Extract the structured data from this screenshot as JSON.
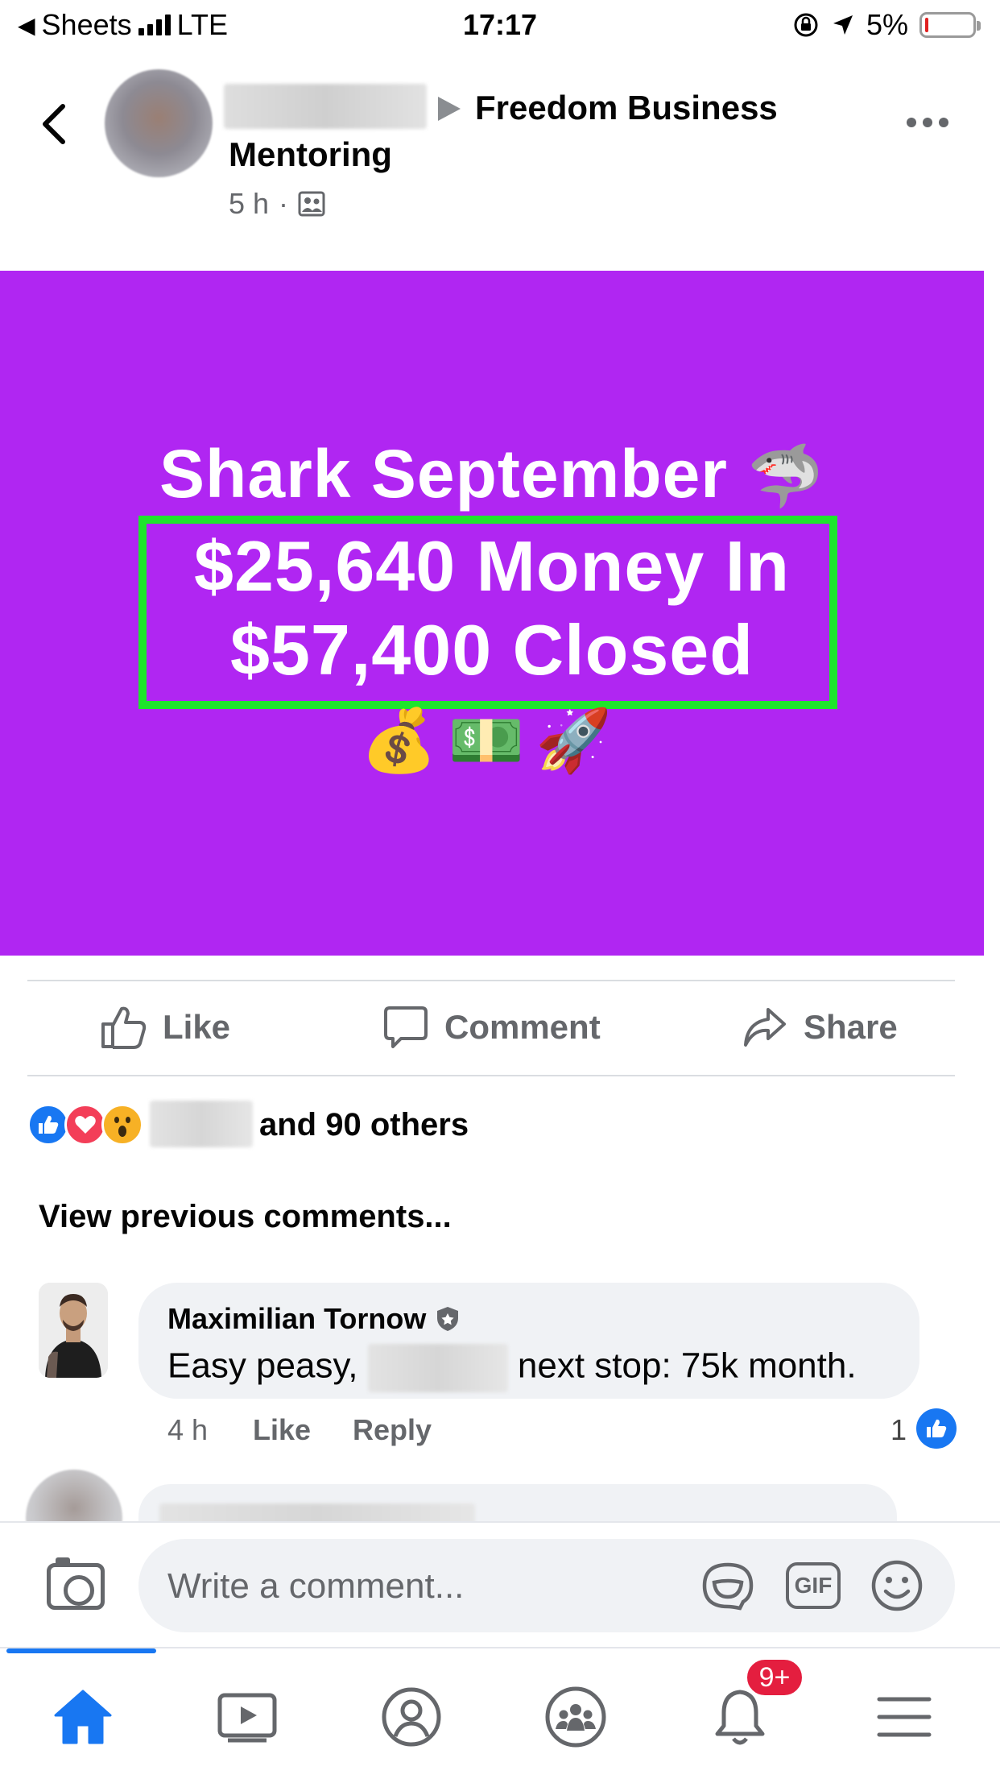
{
  "status_bar": {
    "back_app": "Sheets",
    "network": "LTE",
    "time": "17:17",
    "battery": "5%"
  },
  "post": {
    "group_line1": "Freedom Business",
    "group_line2": "Mentoring",
    "time": "5 h",
    "separator": "·",
    "image_title": "Shark September",
    "image_line2": "$25,640 Money In",
    "image_line3": "$57,400 Closed",
    "title_emoji": "🦈",
    "emoji_row": "💰💵🚀",
    "background_color": "#b026f2",
    "highlight_color": "#1ee52c"
  },
  "actions": {
    "like": "Like",
    "comment": "Comment",
    "share": "Share"
  },
  "reactions": {
    "icons": [
      "like",
      "love",
      "wow"
    ],
    "summary": "and 90 others"
  },
  "comments": {
    "view_previous": "View previous comments...",
    "items": [
      {
        "author": "Maximilian Tornow",
        "text_before": "Easy peasy,",
        "text_after": "next stop: 75k month.",
        "time": "4 h",
        "like": "Like",
        "reply": "Reply",
        "like_count": "1"
      }
    ]
  },
  "composer": {
    "placeholder": "Write a comment...",
    "gif": "GIF"
  },
  "nav": {
    "notification_badge": "9+",
    "accent": "#1877f2"
  }
}
